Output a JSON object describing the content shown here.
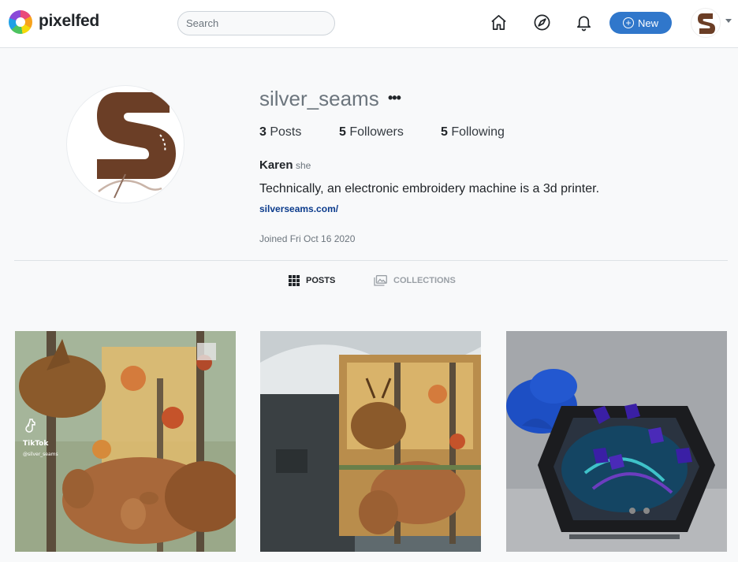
{
  "nav": {
    "brand": "pixelfed",
    "search_placeholder": "Search",
    "new_label": "New"
  },
  "profile": {
    "username": "silver_seams",
    "stats": {
      "posts_count": "3",
      "posts_label": "Posts",
      "followers_count": "5",
      "followers_label": "Followers",
      "following_count": "5",
      "following_label": "Following"
    },
    "display_name": "Karen",
    "pronouns": "she",
    "bio": "Technically, an electronic embroidery machine is a 3d printer.",
    "website": "silverseams.com/",
    "joined": "Joined Fri Oct 16 2020"
  },
  "tabs": [
    {
      "label": "POSTS",
      "icon": "grid-icon"
    },
    {
      "label": "COLLECTIONS",
      "icon": "collections-icon"
    }
  ],
  "posts": [
    {
      "image": "deer fabric with tiktok watermark",
      "overlay_brand": "TikTok",
      "overlay_handle": "@silver_seams"
    },
    {
      "image": "deer fabric under tulle"
    },
    {
      "image": "hexagonal dice tray with blue dice"
    }
  ],
  "colors": {
    "accent": "#3077cb",
    "avatar_brown": "#6b3e26",
    "link": "#0b3b8c"
  }
}
